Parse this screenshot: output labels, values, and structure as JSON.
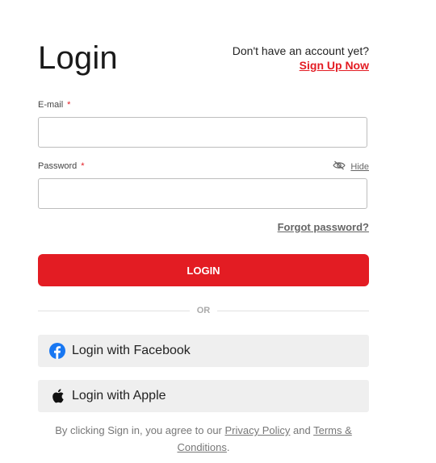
{
  "header": {
    "title": "Login",
    "signup_prompt": "Don't have an account yet?",
    "signup_link": "Sign Up Now"
  },
  "form": {
    "email_label": "E-mail",
    "password_label": "Password",
    "required_mark": "*",
    "hide_label": "Hide",
    "email_value": "",
    "password_value": "",
    "forgot_password": "Forgot password?",
    "login_button": "LOGIN"
  },
  "divider": {
    "text": "OR"
  },
  "social": {
    "facebook_label": "Login with Facebook",
    "facebook_icon": "facebook-icon",
    "apple_label": "Login with Apple",
    "apple_icon": "apple-icon"
  },
  "legal": {
    "prefix": "By clicking Sign in, you agree to our ",
    "privacy_link": "Privacy Policy",
    "middle": " and ",
    "terms_link": "Terms & Conditions",
    "suffix": "."
  },
  "colors": {
    "accent": "#e31c23",
    "facebook": "#1877f2",
    "social_bg": "#efefef"
  }
}
